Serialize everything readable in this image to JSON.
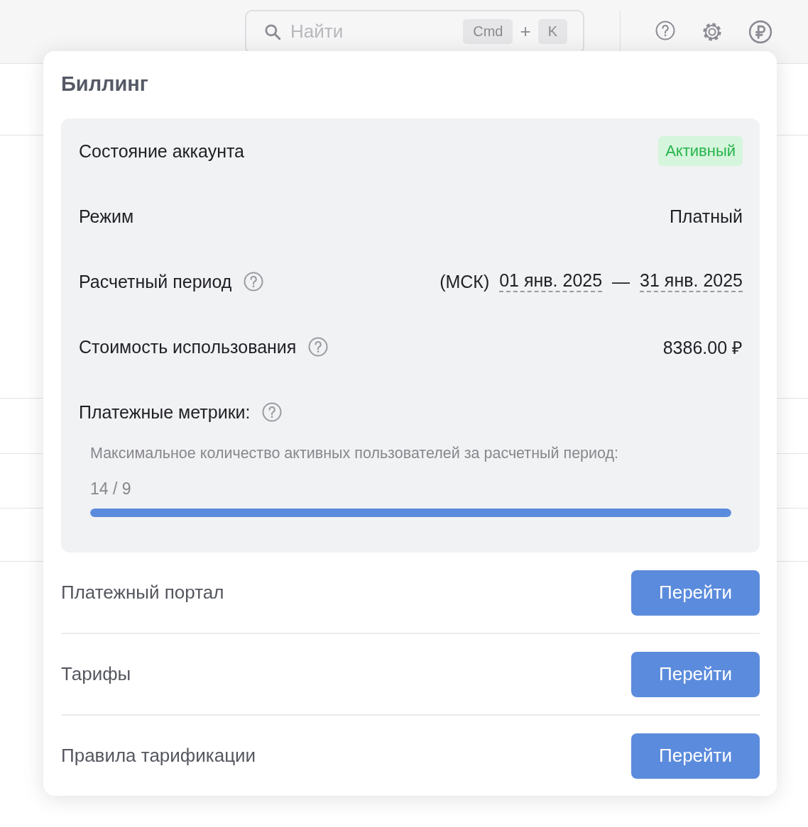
{
  "search": {
    "placeholder": "Найти",
    "keys": [
      "Cmd",
      "K"
    ],
    "joiner": "+"
  },
  "popup": {
    "title": "Биллинг",
    "rows": [
      {
        "kind": "status",
        "label": "Состояние аккаунта",
        "help": false,
        "value": "Активный"
      },
      {
        "kind": "text",
        "label": "Режим",
        "help": false,
        "value": "Платный"
      },
      {
        "kind": "period",
        "label": "Расчетный период",
        "help": true,
        "timezone": "(МСК)",
        "from": "01 янв. 2025",
        "dash": "—",
        "to": "31 янв. 2025"
      },
      {
        "kind": "text",
        "label": "Стоимость использования",
        "help": true,
        "value": "8386.00 ₽"
      }
    ],
    "metrics": {
      "label": "Платежные метрики:",
      "help": true,
      "items": [
        {
          "label": "Максимальное количество активных пользователей за расчетный период:",
          "reading": "14 / 9",
          "level": 1
        }
      ]
    },
    "links": [
      {
        "label": "Платежный портал",
        "button": "Перейти"
      },
      {
        "label": "Тарифы",
        "button": "Перейти"
      },
      {
        "label": "Правила тарификации",
        "button": "Перейти"
      }
    ]
  }
}
